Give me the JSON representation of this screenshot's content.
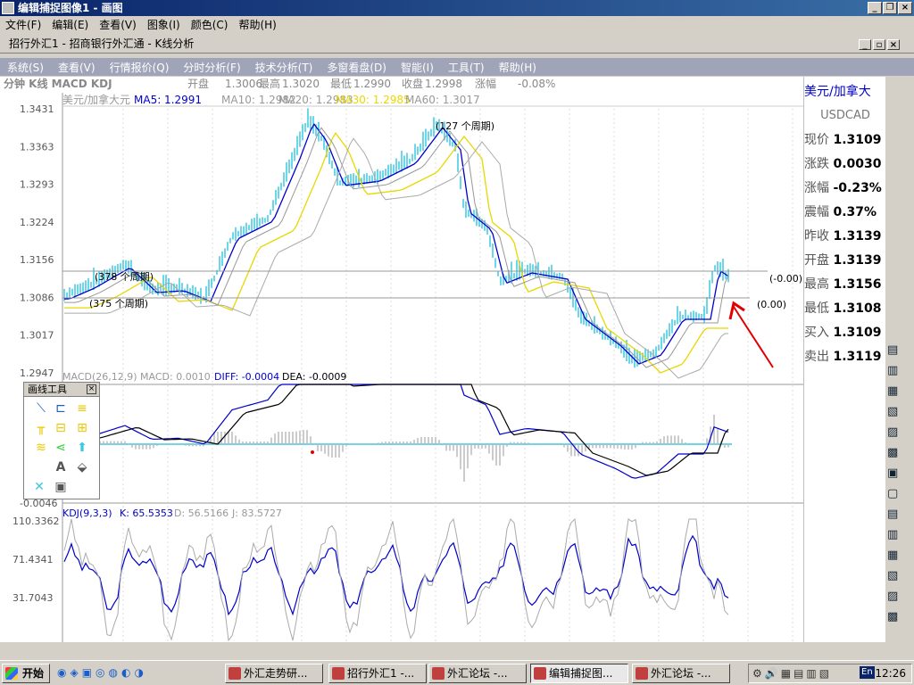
{
  "window": {
    "title": "编辑捕捉图像1 - 画图"
  },
  "outer_menu": [
    "文件(F)",
    "编辑(E)",
    "查看(V)",
    "图象(I)",
    "颜色(C)",
    "帮助(H)"
  ],
  "inner_window": {
    "title": "招行外汇1 - 招商银行外汇通 - K线分析"
  },
  "app_menu": [
    "系统(S)",
    "查看(V)",
    "行情报价(Q)",
    "分时分析(F)",
    "技术分析(T)",
    "多窗看盘(D)",
    "智能(I)",
    "工具(T)",
    "帮助(H)"
  ],
  "quote_bar": {
    "tabs": "分钟 K线 MACD KDJ",
    "open_label": "开盘",
    "open": "1.3006",
    "high_label": "最高",
    "high": "1.3020",
    "low_label": "最低",
    "low": "1.2990",
    "close_label": "收盘",
    "close": "1.2998",
    "change_label": "涨幅",
    "change": "-0.08%"
  },
  "main_chart": {
    "symbol": "美元/加拿大元",
    "ma5": "MA5: 1.2991",
    "ma10": "MA10: 1.2982",
    "ma20": "MA20: 1.2983",
    "ma30": "MA30: 1.2985",
    "ma60": "MA60: 1.3017",
    "yticks": [
      "1.3431",
      "1.3363",
      "1.3293",
      "1.3224",
      "1.3156",
      "1.3086",
      "1.3017",
      "1.2947"
    ],
    "annotations": [
      "(127 个周期)",
      "(378 个周期)",
      "(375 个周期)",
      "(-0.00)",
      "(0.00)"
    ]
  },
  "macd_panel": {
    "label": "MACD(26,12,9) MACD: 0.0010",
    "diff": "DIFF: -0.0004",
    "dea": "DEA: -0.0009",
    "ymin": "-0.0046"
  },
  "kdj_panel": {
    "label": "KDJ(9,3,3)",
    "k": "K: 65.5353",
    "d": "D: 56.5166",
    "j": "J: 83.5727",
    "yticks": [
      "110.3362",
      "71.4341",
      "31.7043"
    ]
  },
  "toolbox": {
    "title": "画线工具",
    "close": "×"
  },
  "right_panel": {
    "pair": "美元/加拿大",
    "code": "USDCAD",
    "rows": [
      {
        "label": "现价",
        "value": "1.3109"
      },
      {
        "label": "涨跌",
        "value": "0.0030"
      },
      {
        "label": "涨幅",
        "value": "-0.23%"
      },
      {
        "label": "震幅",
        "value": "0.37%"
      },
      {
        "label": "昨收",
        "value": "1.3139"
      },
      {
        "label": "开盘",
        "value": "1.3139"
      },
      {
        "label": "最高",
        "value": "1.3156"
      },
      {
        "label": "最低",
        "value": "1.3108"
      },
      {
        "label": "买入",
        "value": "1.3109"
      },
      {
        "label": "卖出",
        "value": "1.3119"
      }
    ]
  },
  "taskbar": {
    "start": "开始",
    "tasks": [
      "外汇走势研...",
      "招行外汇1 -...",
      "外汇论坛 -...",
      "编辑捕捉图...",
      "外汇论坛 -..."
    ],
    "clock": "12:26",
    "lang": "En"
  },
  "colors": {
    "ma5": "#0000cc",
    "ma30": "#e8d800",
    "candle": "#3cc8e0",
    "arrow": "#e00000"
  }
}
